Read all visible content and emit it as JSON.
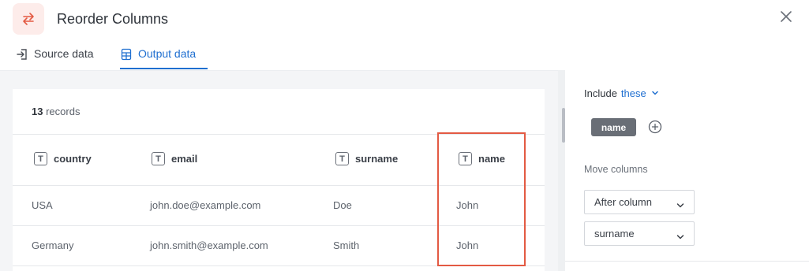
{
  "header": {
    "title": "Reorder Columns",
    "icon": "swap-arrows-icon",
    "accent_color": "#e35a43"
  },
  "tabs": [
    {
      "label": "Source data",
      "icon": "sign-in-icon",
      "active": false
    },
    {
      "label": "Output data",
      "icon": "table-icon",
      "active": true
    }
  ],
  "table": {
    "records_count": "13",
    "records_label": "records",
    "columns": [
      "country",
      "email",
      "surname",
      "name"
    ],
    "rows": [
      [
        "USA",
        "john.doe@example.com",
        "Doe",
        "John"
      ],
      [
        "Germany",
        "john.smith@example.com",
        "Smith",
        "John"
      ]
    ],
    "highlighted_column": "name"
  },
  "panel": {
    "include_label": "Include",
    "include_mode": "these",
    "selected_chips": [
      "name"
    ],
    "move_columns_label": "Move columns",
    "position_select": "After column",
    "reference_column_select": "surname"
  },
  "colors": {
    "link_blue": "#1f6fd0",
    "chip_bg": "#696e76",
    "highlight_border": "#e35a43"
  }
}
